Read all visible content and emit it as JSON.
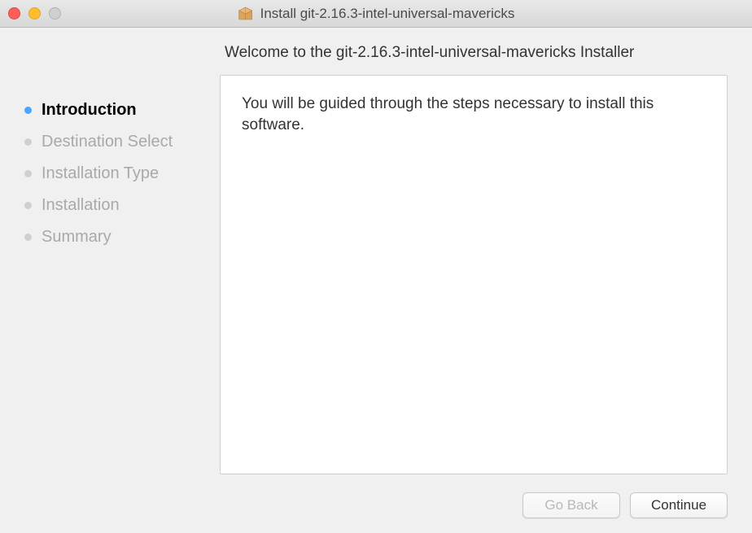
{
  "titlebar": {
    "title": "Install git-2.16.3-intel-universal-mavericks"
  },
  "sidebar": {
    "steps": [
      {
        "label": "Introduction",
        "active": true
      },
      {
        "label": "Destination Select",
        "active": false
      },
      {
        "label": "Installation Type",
        "active": false
      },
      {
        "label": "Installation",
        "active": false
      },
      {
        "label": "Summary",
        "active": false
      }
    ]
  },
  "main": {
    "heading": "Welcome to the git-2.16.3-intel-universal-mavericks Installer",
    "body": "You will be guided through the steps necessary to install this software."
  },
  "buttons": {
    "go_back": "Go Back",
    "continue": "Continue"
  }
}
